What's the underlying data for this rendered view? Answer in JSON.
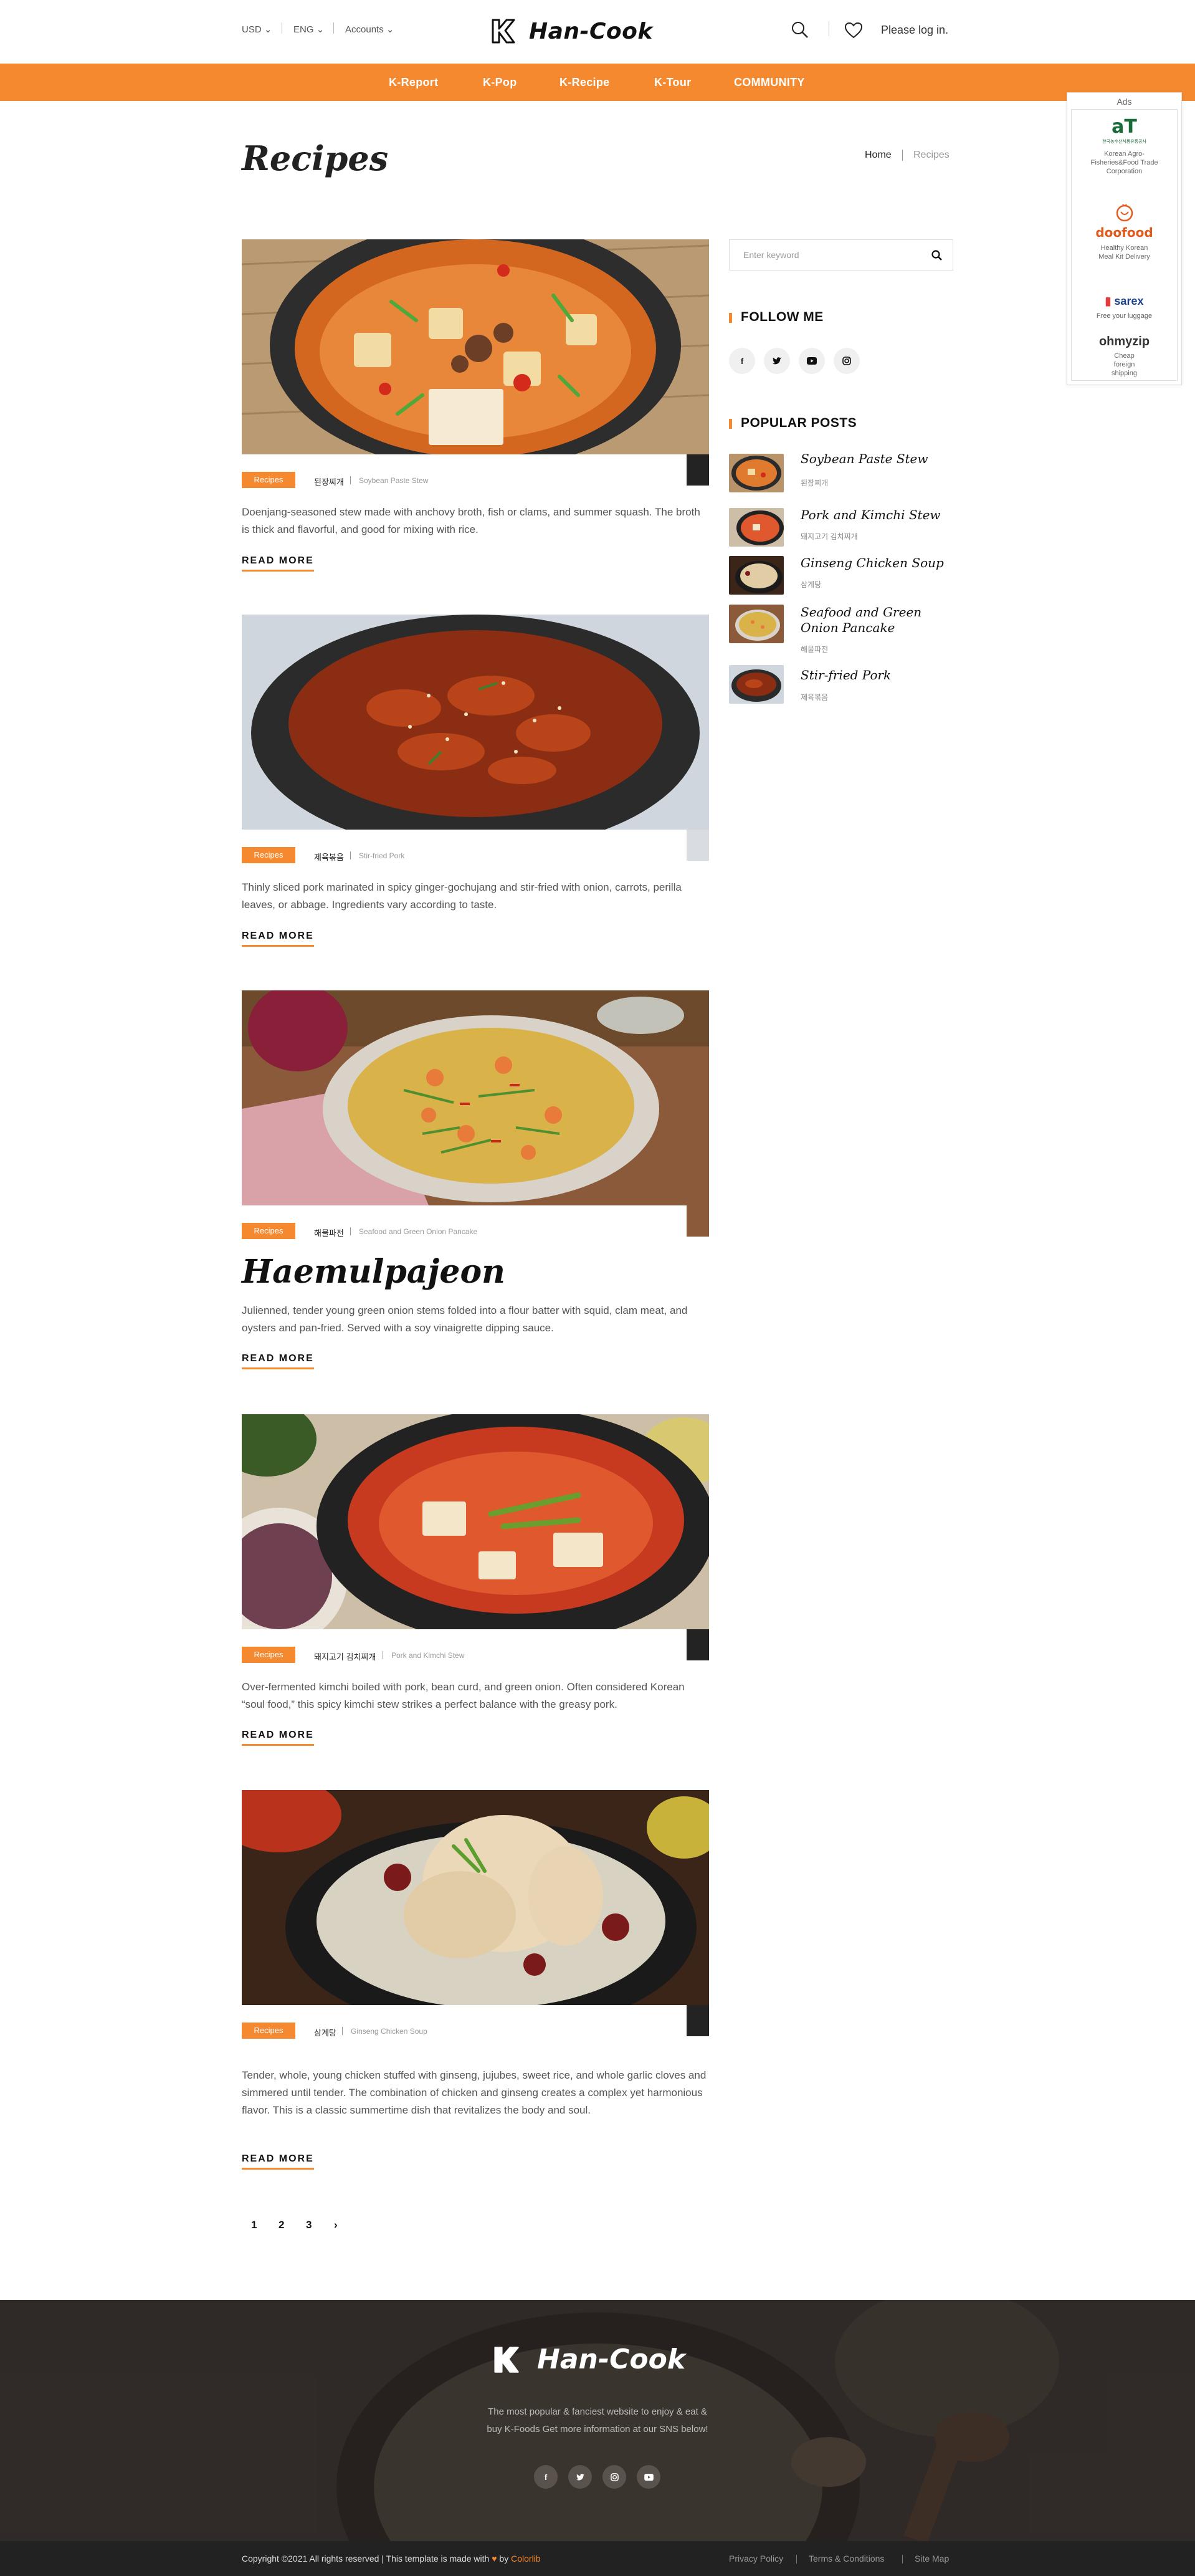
{
  "header": {
    "currency": "USD",
    "language": "ENG",
    "accounts": "Accounts",
    "brand": "Han-Cook",
    "login": "Please log in."
  },
  "nav": [
    "K-Report",
    "K-Pop",
    "K-Recipe",
    "K-Tour",
    "COMMUNITY"
  ],
  "ads": {
    "title": "Ads",
    "items": [
      {
        "logo": "aT",
        "small": "한국농수산식품유통공사",
        "caption": "Korean Agro-Fisheries&Food Trade Corporation"
      },
      {
        "logo": "doofood",
        "caption": "Healthy Korean Meal Kit Delivery"
      },
      {
        "logo": "sarex",
        "caption": "Free your luggage"
      },
      {
        "logo": "ohmyzip",
        "caption": "Cheap foreign shipping"
      }
    ]
  },
  "page": {
    "title": "Recipes",
    "breadcrumb_home": "Home",
    "breadcrumb_current": "Recipes"
  },
  "posts": [
    {
      "badge": "Recipes",
      "tag_ko": "된장찌개",
      "tag_en": "Soybean Paste Stew",
      "heading": "",
      "desc": "Doenjang-seasoned stew made with anchovy broth, fish or clams, and summer squash. The broth is thick and flavorful, and good for mixing with rice.",
      "read_more": "READ MORE"
    },
    {
      "badge": "Recipes",
      "tag_ko": "제육볶음",
      "tag_en": "Stir-fried Pork",
      "heading": "",
      "desc": "Thinly sliced pork marinated in spicy ginger-gochujang and stir-fried with onion, carrots, perilla leaves, or abbage. Ingredients vary according to taste.",
      "read_more": "READ MORE"
    },
    {
      "badge": "Recipes",
      "tag_ko": "해물파전",
      "tag_en": "Seafood and Green Onion Pancake",
      "heading": "Haemulpajeon",
      "desc": "Julienned, tender young green onion stems folded into a flour batter with squid, clam meat, and oysters and pan-fried. Served with a soy vinaigrette dipping sauce.",
      "read_more": "READ MORE"
    },
    {
      "badge": "Recipes",
      "tag_ko": "돼지고기 김치찌개",
      "tag_en": "Pork and Kimchi Stew",
      "heading": "",
      "desc": "Over-fermented kimchi boiled with pork, bean curd, and green onion. Often considered Korean “soul food,” this spicy kimchi stew strikes a perfect balance with the greasy pork.",
      "read_more": "READ MORE"
    },
    {
      "badge": "Recipes",
      "tag_ko": "삼계탕",
      "tag_en": "Ginseng Chicken Soup",
      "heading": "",
      "desc": "Tender, whole, young chicken stuffed with ginseng, jujubes, sweet rice, and whole garlic cloves and simmered until tender. The combination of chicken and ginseng creates a complex yet harmonious flavor. This is a classic summertime dish that revitalizes the body and soul.",
      "read_more": "READ MORE"
    }
  ],
  "pagination": [
    "1",
    "2",
    "3",
    "›"
  ],
  "sidebar": {
    "search_placeholder": "Enter keyword",
    "follow_title": "FOLLOW ME",
    "popular_title": "POPULAR POSTS",
    "popular": [
      {
        "title": "Soybean Paste Stew",
        "sub": "된장찌개"
      },
      {
        "title": "Pork and Kimchi Stew",
        "sub": "돼지고기 김치찌개"
      },
      {
        "title": "Ginseng Chicken Soup",
        "sub": "삼계탕"
      },
      {
        "title": "Seafood and Green Onion Pancake",
        "sub": "해물파전"
      },
      {
        "title": "Stir-fried Pork",
        "sub": "제육볶음"
      }
    ]
  },
  "footer": {
    "brand": "Han-Cook",
    "desc": "The most popular & fanciest website to enjoy & eat & buy K-Foods Get more information at our SNS below!",
    "copyright": "Copyright ©2021 All rights reserved | This template is made with",
    "by": "by",
    "colorlib": "Colorlib",
    "links": [
      "Privacy Policy",
      "Terms & Conditions",
      "Site Map"
    ]
  },
  "colors": {
    "accent": "#f5892f",
    "footer_bg": "#3a3430"
  }
}
